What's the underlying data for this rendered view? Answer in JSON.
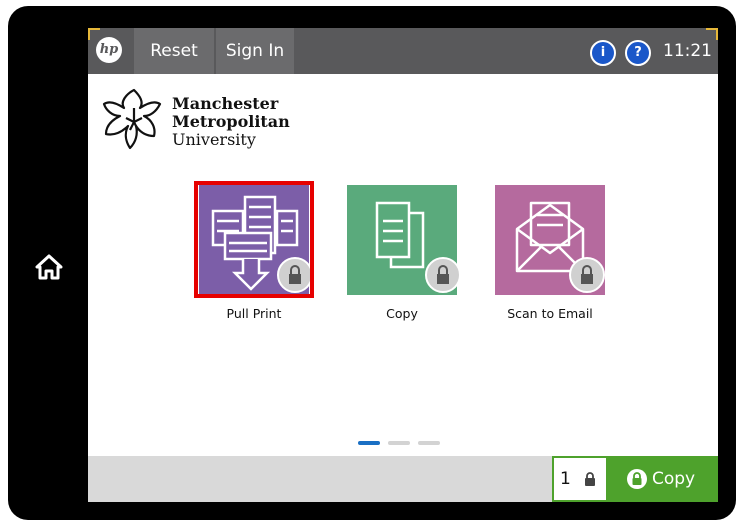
{
  "header": {
    "brand_logo": "hp",
    "reset_label": "Reset",
    "signin_label": "Sign In",
    "info_glyph": "i",
    "help_glyph": "?",
    "time": "11:21"
  },
  "logo": {
    "line1": "Manchester",
    "line2": "Metropolitan",
    "line3": "University"
  },
  "apps": [
    {
      "label": "Pull Print",
      "color": "#7c5ea8",
      "locked": true,
      "selected": true,
      "icon": "pull-print-icon"
    },
    {
      "label": "Copy",
      "color": "#5aaa7c",
      "locked": true,
      "selected": false,
      "icon": "copy-icon"
    },
    {
      "label": "Scan to Email",
      "color": "#b56a9e",
      "locked": true,
      "selected": false,
      "icon": "email-envelope-icon"
    }
  ],
  "pager": {
    "active_index": 0,
    "count": 3,
    "active_color": "#1a6fc4"
  },
  "footer": {
    "copies": "1",
    "copy_button_label": "Copy",
    "accent": "#4ea22c"
  },
  "colors": {
    "top_bar": "#59595b",
    "corner_accent": "#e6b83a",
    "selection": "#e60000"
  }
}
